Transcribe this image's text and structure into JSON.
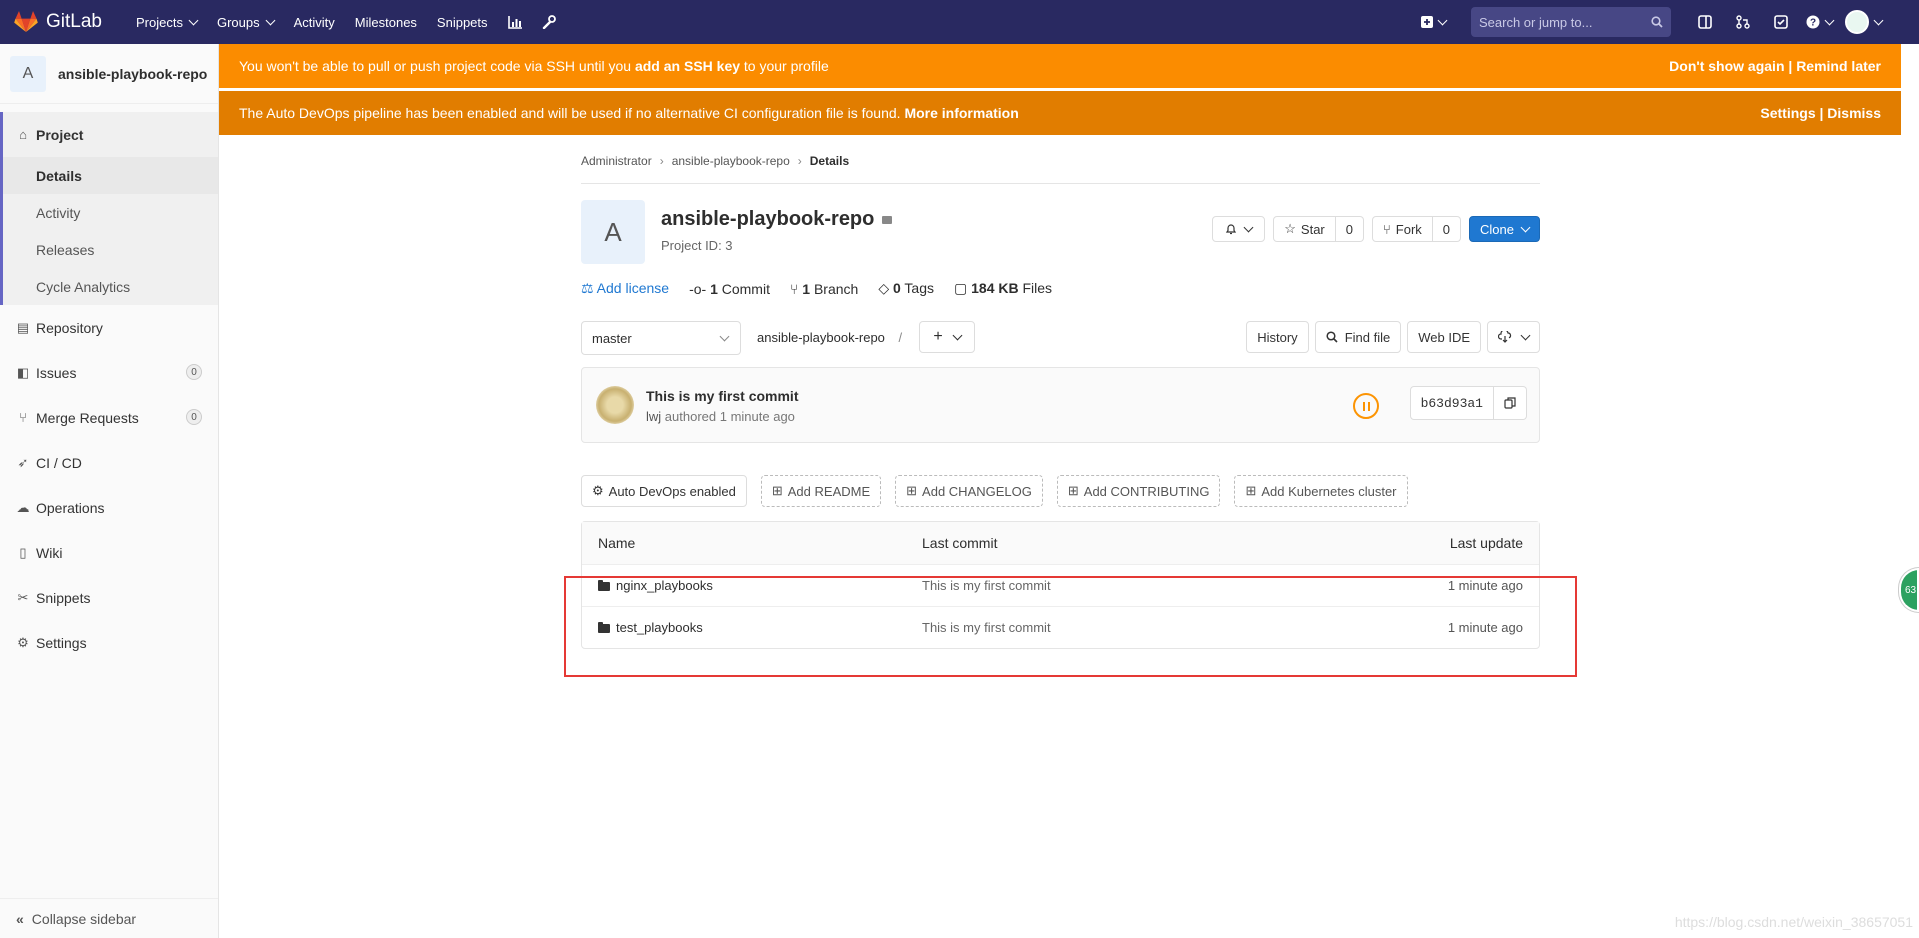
{
  "topnav": {
    "brand": "GitLab",
    "links": [
      "Projects",
      "Groups",
      "Activity",
      "Milestones",
      "Snippets"
    ],
    "search_placeholder": "Search or jump to..."
  },
  "sidebar": {
    "project_initial": "A",
    "project_name": "ansible-playbook-repo",
    "section": "Project",
    "subitems": [
      "Details",
      "Activity",
      "Releases",
      "Cycle Analytics"
    ],
    "items": [
      {
        "label": "Repository"
      },
      {
        "label": "Issues",
        "count": "0"
      },
      {
        "label": "Merge Requests",
        "count": "0"
      },
      {
        "label": "CI / CD"
      },
      {
        "label": "Operations"
      },
      {
        "label": "Wiki"
      },
      {
        "label": "Snippets"
      },
      {
        "label": "Settings"
      }
    ],
    "collapse": "Collapse sidebar"
  },
  "banners": {
    "ssh_pre": "You won't be able to pull or push project code via SSH until you ",
    "ssh_link": "add an SSH key",
    "ssh_post": " to your profile",
    "ssh_right": "Don't show again | Remind later",
    "devops_text": "The Auto DevOps pipeline has been enabled and will be used if no alternative CI configuration file is found. ",
    "devops_link": "More information",
    "devops_right": "Settings | Dismiss"
  },
  "breadcrumb": [
    "Administrator",
    "ansible-playbook-repo",
    "Details"
  ],
  "project": {
    "initial": "A",
    "name": "ansible-playbook-repo",
    "id_text": "Project ID: 3",
    "star_label": "Star",
    "star_count": "0",
    "fork_label": "Fork",
    "fork_count": "0",
    "clone_label": "Clone"
  },
  "stats": {
    "license": "Add license",
    "commits_num": "1",
    "commits_label": "Commit",
    "branches_num": "1",
    "branches_label": "Branch",
    "tags_num": "0",
    "tags_label": "Tags",
    "size_num": "184 KB",
    "size_label": "Files"
  },
  "branchbar": {
    "branch": "master",
    "path": "ansible-playbook-repo",
    "path_sep": "/",
    "history": "History",
    "find_file": "Find file",
    "web_ide": "Web IDE"
  },
  "commit": {
    "title": "This is my first commit",
    "author": "lwj",
    "authored": "authored",
    "time": "1 minute ago",
    "sha": "b63d93a1"
  },
  "suggestions": [
    "Auto DevOps enabled",
    "Add README",
    "Add CHANGELOG",
    "Add CONTRIBUTING",
    "Add Kubernetes cluster"
  ],
  "table": {
    "headers": {
      "name": "Name",
      "commit": "Last commit",
      "date": "Last update"
    },
    "rows": [
      {
        "name": "nginx_playbooks",
        "commit": "This is my first commit",
        "date": "1 minute ago"
      },
      {
        "name": "test_playbooks",
        "commit": "This is my first commit",
        "date": "1 minute ago"
      }
    ]
  },
  "float_badge": "63",
  "watermark": "https://blog.csdn.net/weixin_38657051",
  "colors": {
    "nav": "#292961",
    "banner1": "#fb8c00",
    "banner2": "#e17d00",
    "accent": "#1f78d1",
    "highlight_box": "#e53935"
  }
}
